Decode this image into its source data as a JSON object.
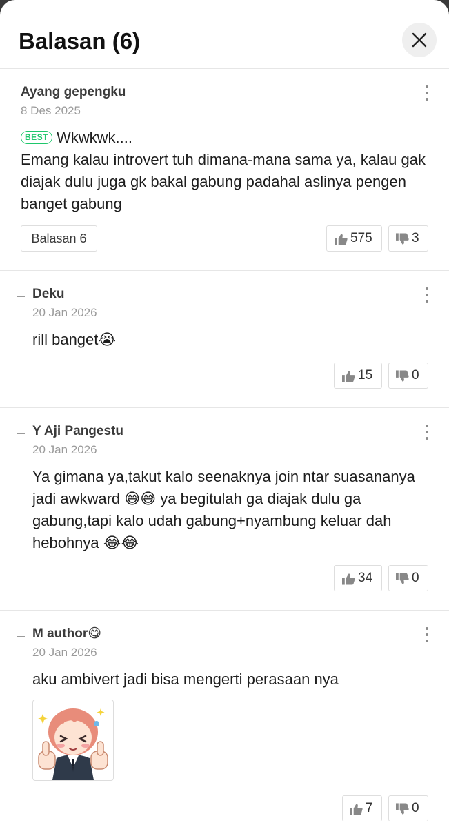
{
  "header": {
    "title": "Balasan (6)"
  },
  "comments": [
    {
      "author": "Ayang gepengku",
      "date": "8 Des 2025",
      "badge": "BEST",
      "text": "Wkwkwk.... \nEmang kalau introvert tuh dimana-mana sama ya, kalau gak diajak dulu juga gk bakal gabung padahal aslinya pengen banget gabung",
      "replies_label": "Balasan 6",
      "likes": "575",
      "dislikes": "3"
    },
    {
      "author": "Deku",
      "date": "20 Jan 2026",
      "text": "rill banget😭",
      "likes": "15",
      "dislikes": "0"
    },
    {
      "author": "Y Aji Pangestu",
      "date": "20 Jan 2026",
      "text": "Ya gimana ya,takut kalo seenaknya join ntar suasananya jadi awkward 😅😅 ya begitulah ga diajak dulu ga gabung,tapi kalo udah gabung+nyambung keluar dah hebohnya 😂😂",
      "likes": "34",
      "dislikes": "0"
    },
    {
      "author": "M author😋",
      "date": "20 Jan 2026",
      "text": "aku ambivert jadi bisa mengerti perasaan nya",
      "sticker": "anime-girl-thumbs-up-sticker",
      "likes": "7",
      "dislikes": "0"
    }
  ],
  "icons": {
    "close": "close-icon",
    "menu": "more-vertical-icon",
    "like": "thumbs-up-icon",
    "dislike": "thumbs-down-icon",
    "reply": "reply-indent-icon"
  },
  "colors": {
    "best_badge": "#1ec76b",
    "text": "#1e1e1e",
    "muted": "#9a9a9a",
    "divider": "#e6e6e6"
  }
}
